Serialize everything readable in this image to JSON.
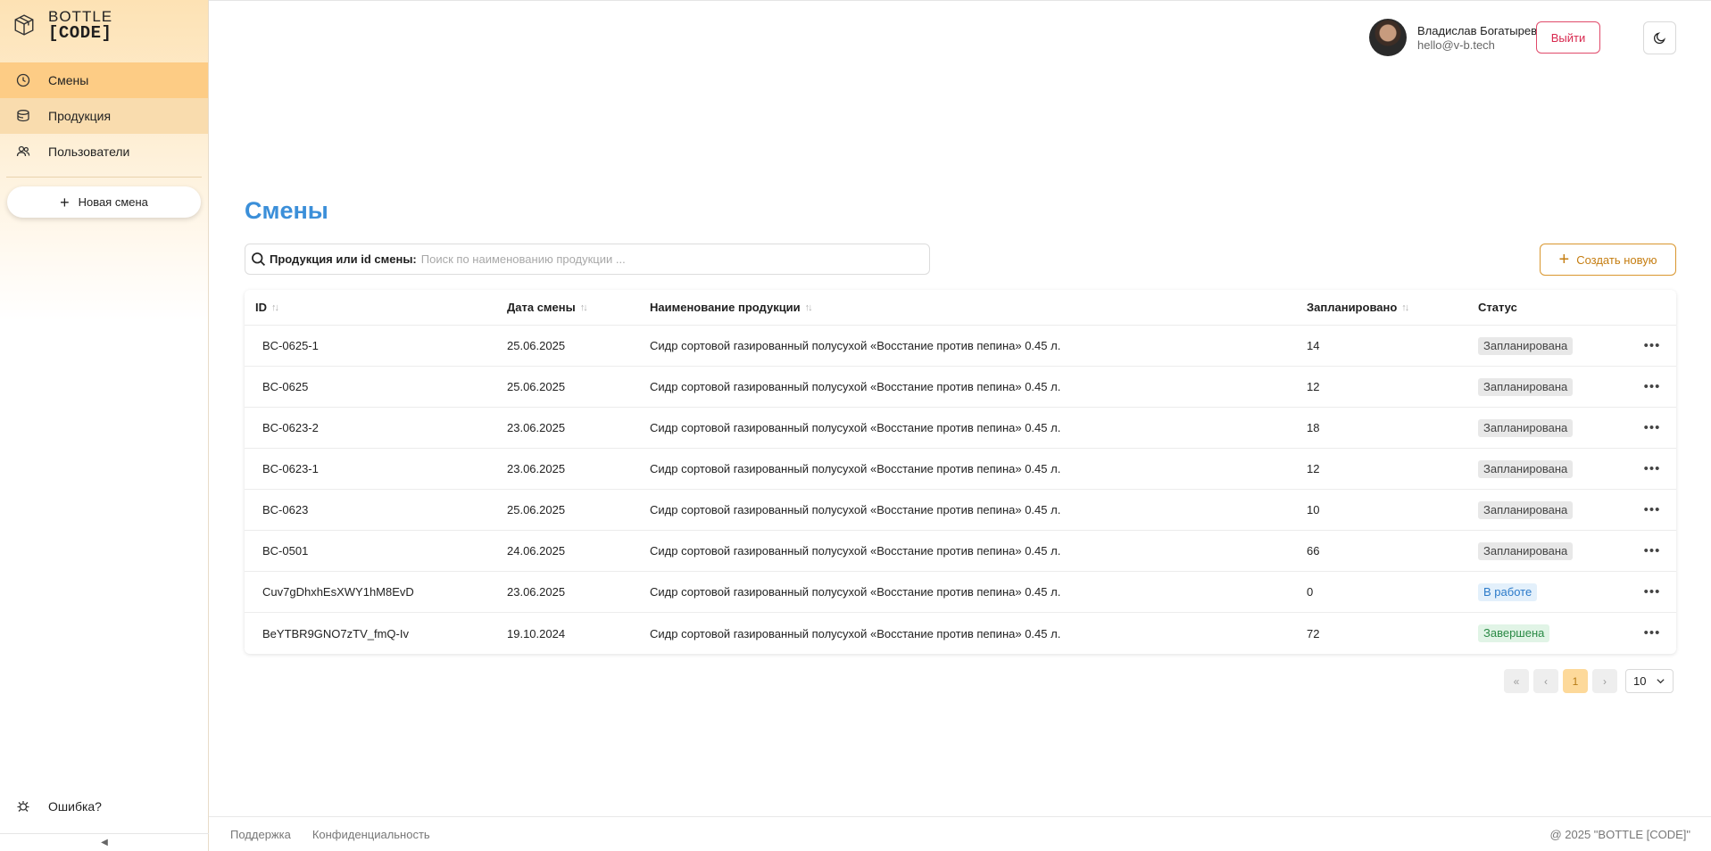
{
  "brand": {
    "line1": "BOTTLE",
    "line2": "[CODE]"
  },
  "sidebar": {
    "items": [
      {
        "label": "Смены",
        "icon": "clock-icon"
      },
      {
        "label": "Продукция",
        "icon": "package-icon"
      },
      {
        "label": "Пользователи",
        "icon": "users-icon"
      }
    ],
    "new_shift_label": "Новая смена",
    "error_label": "Ошибка?",
    "collapse_glyph": "◀"
  },
  "header": {
    "user_name": "Владислав Богатырев",
    "user_email": "hello@v-b.tech",
    "logout_label": "Выйти",
    "theme_icon": "moon-icon"
  },
  "main": {
    "title": "Смены",
    "search": {
      "label": "Продукция или id смены:",
      "placeholder": "Поиск по наименованию продукции ...",
      "value": ""
    },
    "create_label": "Создать новую"
  },
  "table": {
    "columns": [
      "ID",
      "Дата смены",
      "Наименование продукции",
      "Запланировано",
      "Статус"
    ],
    "rows": [
      {
        "id": "BC-0625-1",
        "date": "25.06.2025",
        "name": "Сидр сортовой газированный полусухой «Восстание против пепина» 0.45 л.",
        "planned": "14",
        "status": "Запланирована",
        "status_kind": "planned"
      },
      {
        "id": "BC-0625",
        "date": "25.06.2025",
        "name": "Сидр сортовой газированный полусухой «Восстание против пепина» 0.45 л.",
        "planned": "12",
        "status": "Запланирована",
        "status_kind": "planned"
      },
      {
        "id": "BC-0623-2",
        "date": "23.06.2025",
        "name": "Сидр сортовой газированный полусухой «Восстание против пепина» 0.45 л.",
        "planned": "18",
        "status": "Запланирована",
        "status_kind": "planned"
      },
      {
        "id": "BC-0623-1",
        "date": "23.06.2025",
        "name": "Сидр сортовой газированный полусухой «Восстание против пепина» 0.45 л.",
        "planned": "12",
        "status": "Запланирована",
        "status_kind": "planned"
      },
      {
        "id": "BC-0623",
        "date": "25.06.2025",
        "name": "Сидр сортовой газированный полусухой «Восстание против пепина» 0.45 л.",
        "planned": "10",
        "status": "Запланирована",
        "status_kind": "planned"
      },
      {
        "id": "BC-0501",
        "date": "24.06.2025",
        "name": "Сидр сортовой газированный полусухой «Восстание против пепина» 0.45 л.",
        "planned": "66",
        "status": "Запланирована",
        "status_kind": "planned"
      },
      {
        "id": "Cuv7gDhxhEsXWY1hM8EvD",
        "date": "23.06.2025",
        "name": "Сидр сортовой газированный полусухой «Восстание против пепина» 0.45 л.",
        "planned": "0",
        "status": "В работе",
        "status_kind": "work"
      },
      {
        "id": "BeYTBR9GNO7zTV_fmQ-Iv",
        "date": "19.10.2024",
        "name": "Сидр сортовой газированный полусухой «Восстание против пепина» 0.45 л.",
        "planned": "72",
        "status": "Завершена",
        "status_kind": "done"
      }
    ]
  },
  "pagination": {
    "current_page": "1",
    "page_size": "10",
    "first_glyph": "«",
    "prev_glyph": "‹",
    "next_glyph": "›"
  },
  "footer": {
    "support": "Поддержка",
    "privacy": "Конфиденциальность",
    "copyright": "@ 2025 \"BOTTLE [CODE]\""
  },
  "colors": {
    "accent": "#3b8fd9",
    "sidebar_active": "#fdcc85",
    "create_border": "#d9962e",
    "logout": "#d8284e"
  }
}
